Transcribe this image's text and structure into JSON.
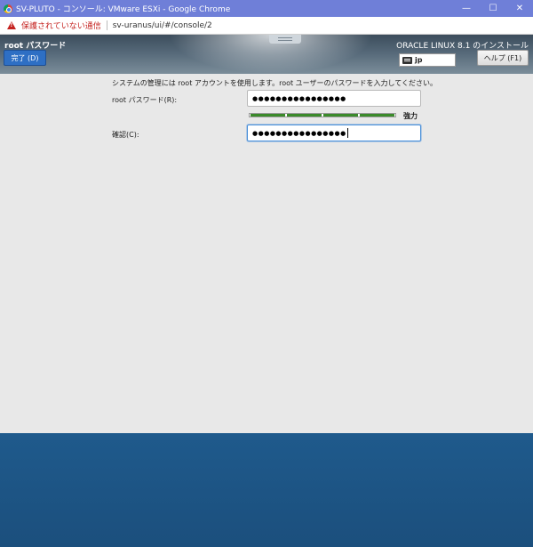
{
  "window": {
    "title": "SV-PLUTO - コンソール: VMware ESXi - Google Chrome",
    "minimize": "—",
    "maximize": "☐",
    "close": "✕"
  },
  "address_bar": {
    "security_text": "保護されていない通信",
    "url": "sv-uranus/ui/#/console/2"
  },
  "installer_header": {
    "spoke_title": "root パスワード",
    "done_button": "完了 (D)",
    "product_title": "ORACLE LINUX 8.1 のインストール",
    "keyboard_layout": "jp",
    "help_button": "ヘルプ (F1)"
  },
  "form": {
    "instructions": "システムの管理には root アカウントを使用します。root ユーザーのパスワードを入力してください。",
    "password_label": "root パスワード(R):",
    "password_value": "●●●●●●●●●●●●●●●●",
    "strength": 1.0,
    "strength_label": "強力",
    "confirm_label": "確認(C):",
    "confirm_value": "●●●●●●●●●●●●●●●●"
  },
  "colors": {
    "titlebar": "#6f7fd8",
    "accent_button": "#2e6fc4",
    "strength_bar": "#3a8a2a",
    "bottom_panel": "#1f5a8c"
  }
}
